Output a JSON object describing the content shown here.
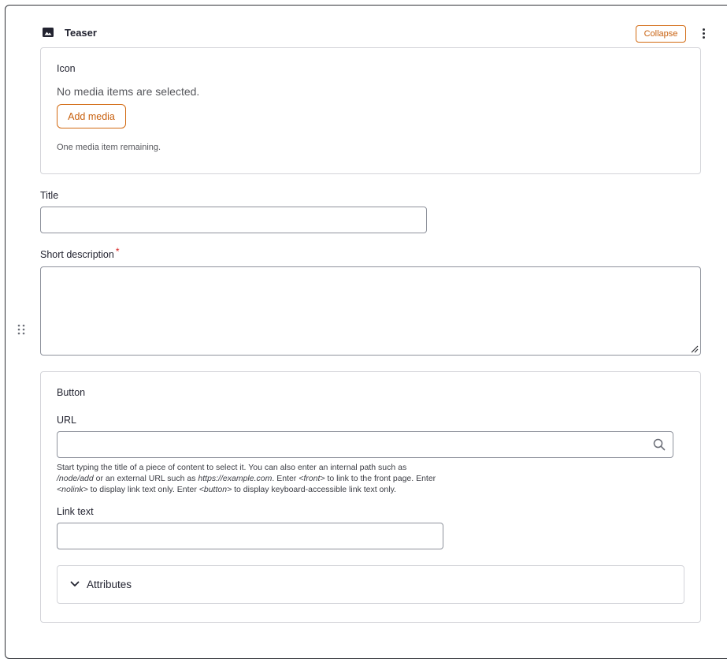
{
  "paragraph": {
    "title": "Teaser",
    "type_icon": "image-icon",
    "collapse_label": "Collapse",
    "actions_icon": "kebab-menu-icon",
    "drag_icon": "drag-handle-icon"
  },
  "icon_field": {
    "legend": "Icon",
    "empty_text": "No media items are selected.",
    "add_button_label": "Add media",
    "remaining_text": "One media item remaining."
  },
  "title_field": {
    "label": "Title",
    "value": ""
  },
  "short_description": {
    "label": "Short description",
    "required_marker": "*",
    "value": ""
  },
  "button_group": {
    "legend": "Button",
    "url": {
      "label": "URL",
      "value": "",
      "icon": "search-icon"
    },
    "help": {
      "t1": "Start typing the title of a piece of content to select it. You can also enter an internal path such as",
      "e1": "/node/add",
      "t2": " or an external URL such as ",
      "e2": "https://example.com",
      "t3": ". Enter ",
      "e3": "<front>",
      "t4": " to link to the front page. Enter",
      "e4": "<nolink>",
      "t5": " to display link text only. Enter ",
      "e5": "<button>",
      "t6": " to display keyboard-accessible link text only."
    },
    "link_text": {
      "label": "Link text",
      "value": ""
    },
    "attributes": {
      "label": "Attributes",
      "icon": "chevron-down-icon"
    }
  },
  "colors": {
    "accent": "#d26a12",
    "border": "#d3d4d9",
    "required": "#d72222"
  }
}
